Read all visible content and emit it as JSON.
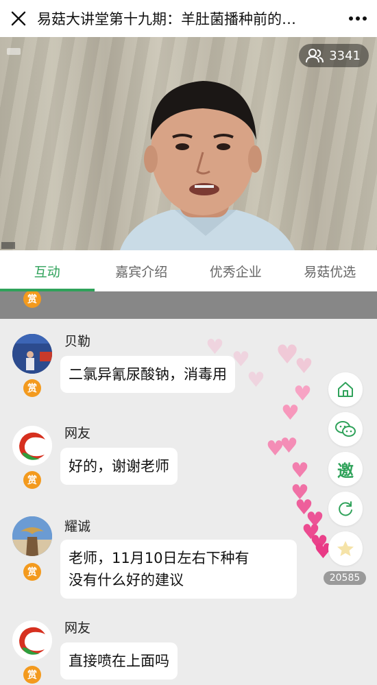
{
  "header": {
    "title": "易菇大讲堂第十九期：羊肚菌播种前的…",
    "close_icon": "close-icon",
    "more_icon": "more-dots-icon"
  },
  "video": {
    "viewer_count": "3341"
  },
  "tabs": [
    {
      "label": "互动",
      "active": true
    },
    {
      "label": "嘉宾介绍",
      "active": false
    },
    {
      "label": "优秀企业",
      "active": false
    },
    {
      "label": "易菇优选",
      "active": false
    }
  ],
  "messages": [
    {
      "name": "贝勒",
      "text": "二氯异氰尿酸钠，消毒用",
      "reward": "赏",
      "avatar": "photo-avatar"
    },
    {
      "name": "网友",
      "text": "好的，谢谢老师",
      "reward": "赏",
      "avatar": "logo-avatar"
    },
    {
      "name": "耀诚",
      "text": "老师，11月10日左右下种有没有什么好的建议",
      "line1": "老师，11月10日左右下种有",
      "line2": "没有什么好的建议",
      "reward": "赏",
      "avatar": "statue-avatar"
    },
    {
      "name": "网友",
      "text": "直接喷在上面吗",
      "reward": "赏",
      "avatar": "logo-avatar"
    }
  ],
  "top_reward": "赏",
  "side_buttons": {
    "home_icon": "home-icon",
    "wechat_icon": "wechat-icon",
    "invite_label": "邀",
    "refresh_icon": "refresh-icon",
    "like_icon": "like-icon",
    "like_count": "20585"
  },
  "colors": {
    "accent": "#2fa25a",
    "reward": "#f39a1e",
    "heart": "#f25b9a"
  }
}
